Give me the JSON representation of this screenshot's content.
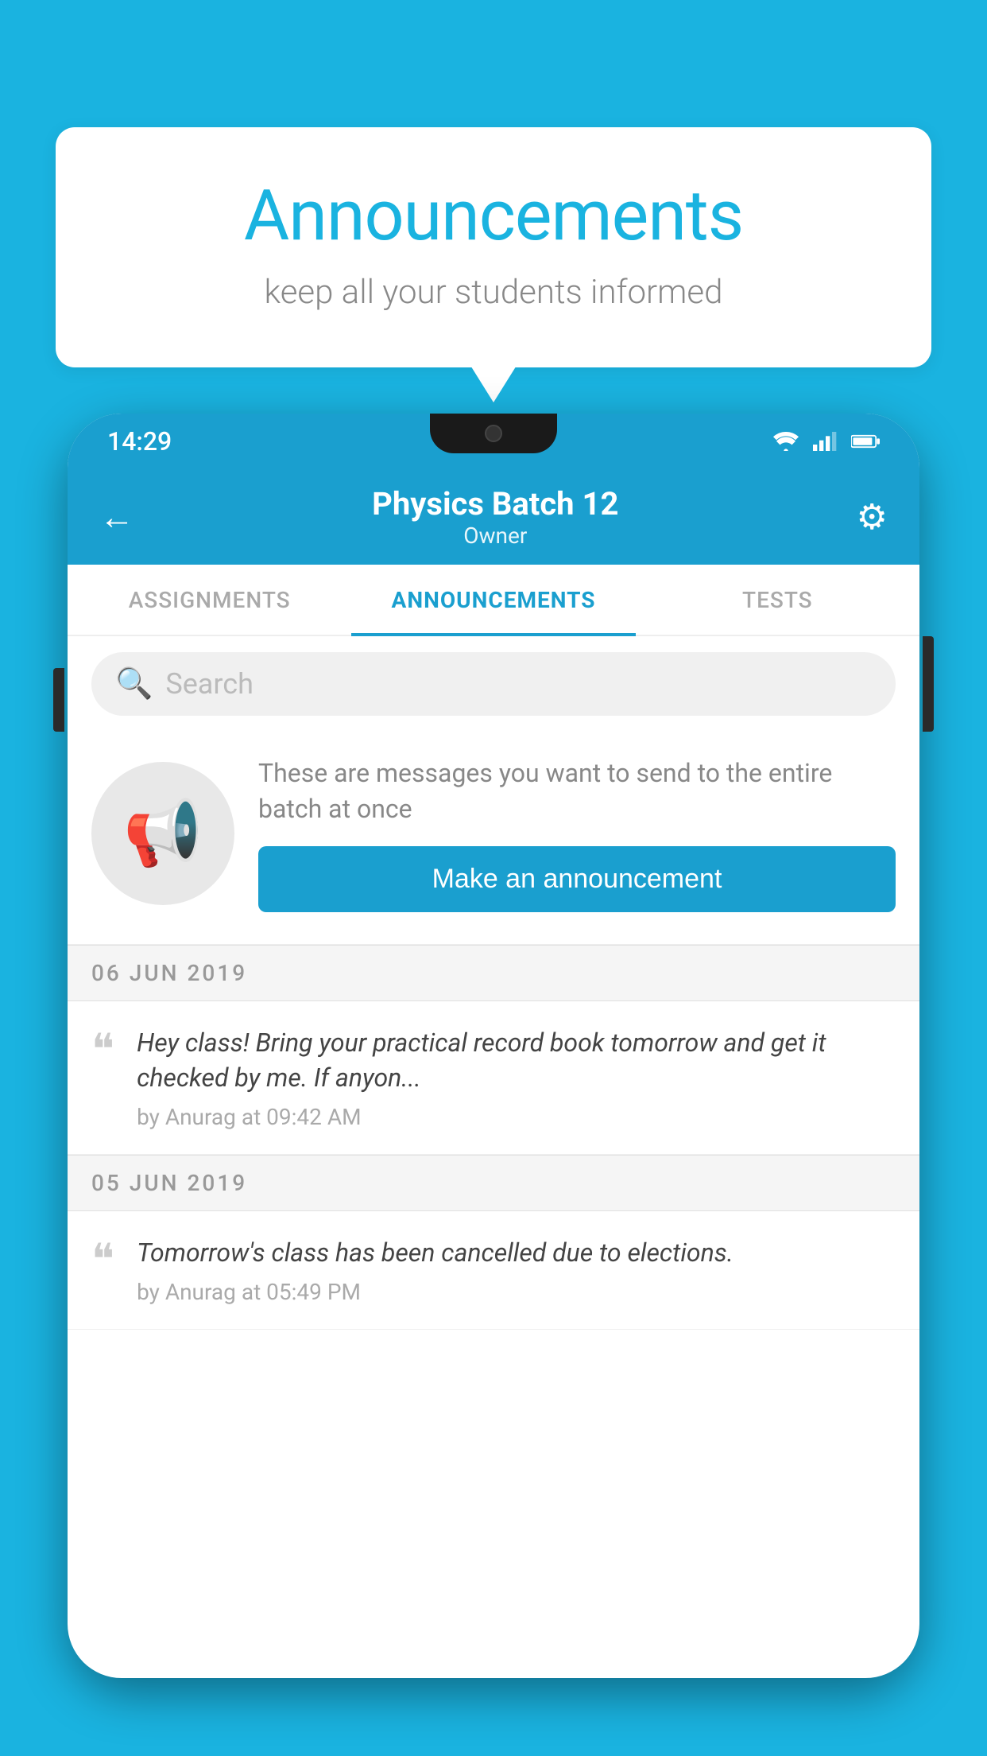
{
  "bubble": {
    "title": "Announcements",
    "subtitle": "keep all your students informed"
  },
  "statusBar": {
    "time": "14:29"
  },
  "appHeader": {
    "batchName": "Physics Batch 12",
    "role": "Owner"
  },
  "tabs": [
    {
      "label": "ASSIGNMENTS",
      "active": false
    },
    {
      "label": "ANNOUNCEMENTS",
      "active": true
    },
    {
      "label": "TESTS",
      "active": false
    }
  ],
  "search": {
    "placeholder": "Search"
  },
  "promo": {
    "description": "These are messages you want to send to the entire batch at once",
    "buttonLabel": "Make an announcement"
  },
  "announcements": [
    {
      "date": "06  JUN  2019",
      "text": "Hey class! Bring your practical record book tomorrow and get it checked by me. If anyon...",
      "meta": "by Anurag at 09:42 AM"
    },
    {
      "date": "05  JUN  2019",
      "text": "Tomorrow's class has been cancelled due to elections.",
      "meta": "by Anurag at 05:49 PM"
    }
  ]
}
